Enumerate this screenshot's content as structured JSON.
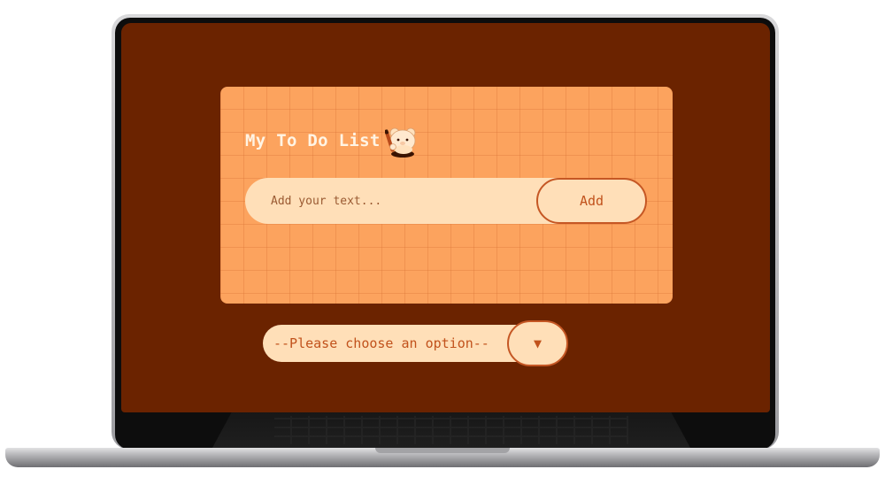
{
  "app": {
    "title": "My To Do List",
    "mascot_icon": "bear-with-pencil-icon"
  },
  "task_form": {
    "input_placeholder": "Add your text...",
    "input_value": "",
    "add_label": "Add"
  },
  "filter": {
    "selected_option": "--Please choose an option--",
    "arrow_glyph": "▼"
  },
  "colors": {
    "screen_background": "#6b2300",
    "card_background": "#fca35e",
    "input_background": "#ffdfb8",
    "accent": "#c1521c",
    "title_text": "#fff4e4"
  }
}
